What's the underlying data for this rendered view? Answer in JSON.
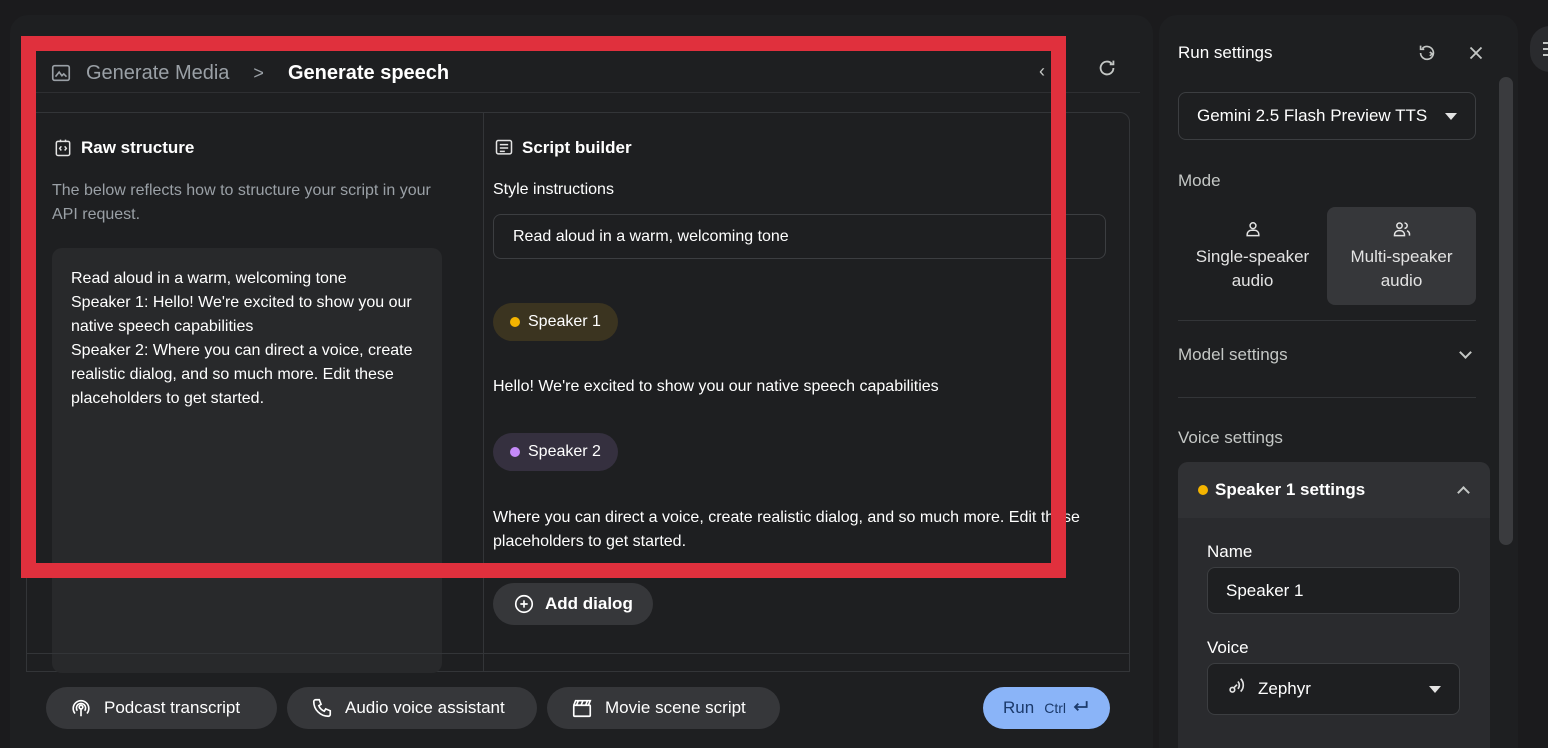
{
  "breadcrumb": {
    "parent": "Generate Media",
    "separator": ">",
    "current": "Generate speech"
  },
  "header": {
    "collapse_icon": "chevron-left-icon",
    "refresh_icon": "refresh-icon"
  },
  "raw_structure": {
    "title": "Raw structure",
    "description": "The below reflects how to structure your script in your API request.",
    "content": "Read aloud in a warm, welcoming tone\nSpeaker 1: Hello! We're excited to show you our native speech capabilities\nSpeaker 2: Where you can direct a voice, create realistic dialog, and so much more. Edit these placeholders to get started."
  },
  "script_builder": {
    "title": "Script builder",
    "style_label": "Style instructions",
    "style_value": "Read aloud in a warm, welcoming tone",
    "dialogs": [
      {
        "speaker": "Speaker 1",
        "color": "#f4b400",
        "text": "Hello! We're excited to show you our native speech capabilities"
      },
      {
        "speaker": "Speaker 2",
        "color": "#c58af9",
        "text": "Where you can direct a voice, create realistic dialog, and so much more. Edit these placeholders to get started."
      }
    ],
    "add_dialog_label": "Add dialog"
  },
  "presets": [
    {
      "label": "Podcast transcript",
      "icon": "podcast-icon"
    },
    {
      "label": "Audio voice assistant",
      "icon": "phone-icon"
    },
    {
      "label": "Movie scene script",
      "icon": "clapperboard-icon"
    }
  ],
  "run": {
    "label": "Run",
    "shortcut": "Ctrl"
  },
  "settings": {
    "title": "Run settings",
    "model": "Gemini 2.5 Flash Preview TTS",
    "mode_label": "Mode",
    "modes": [
      {
        "label": "Single-speaker audio",
        "selected": false
      },
      {
        "label": "Multi-speaker audio",
        "selected": true
      }
    ],
    "model_settings_label": "Model settings",
    "voice_settings_label": "Voice settings",
    "speaker_settings_title": "Speaker 1 settings",
    "name_label": "Name",
    "name_value": "Speaker 1",
    "voice_label": "Voice",
    "voice_value": "Zephyr"
  },
  "colors": {
    "highlight": "#e0303d",
    "accent": "#8ab4f8",
    "speaker1": "#f4b400",
    "speaker2": "#c58af9"
  }
}
